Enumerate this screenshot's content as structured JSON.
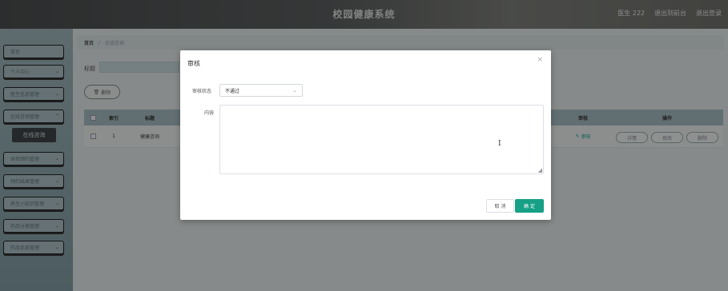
{
  "header": {
    "title": "校园健康系统",
    "user_label": "医生 222",
    "back_label": "退出到前台",
    "logout_label": "退出登录"
  },
  "sidebar": {
    "items": [
      {
        "label": "首页",
        "has_chevron": false
      },
      {
        "label": "个人中心",
        "has_chevron": true
      },
      {
        "label": "医生信息管理",
        "has_chevron": true
      },
      {
        "label": "在线咨询管理",
        "has_chevron": true
      },
      {
        "label": "体检预约管理",
        "has_chevron": true
      },
      {
        "label": "预约结果管理",
        "has_chevron": true
      },
      {
        "label": "养生小知识管理",
        "has_chevron": true
      },
      {
        "label": "药品分类管理",
        "has_chevron": true
      },
      {
        "label": "药品信息管理",
        "has_chevron": true
      }
    ],
    "active_sub": "在线咨询"
  },
  "breadcrumb": {
    "home": "首页",
    "current": "在线咨询"
  },
  "search": {
    "label": "标题"
  },
  "toolbar": {
    "delete_label": "删除"
  },
  "table": {
    "headers": [
      "索引",
      "标题",
      "审核",
      "操作"
    ],
    "rows": [
      {
        "index": "1",
        "title": "健康咨询",
        "audit": "审核"
      }
    ],
    "row_actions": [
      "详情",
      "修改",
      "删除"
    ]
  },
  "modal": {
    "title": "审核",
    "status_label": "审核状态",
    "status_value": "不通过",
    "content_label": "内容",
    "cancel_label": "取 消",
    "ok_label": "确 定"
  },
  "colors": {
    "accent": "#16a085"
  }
}
